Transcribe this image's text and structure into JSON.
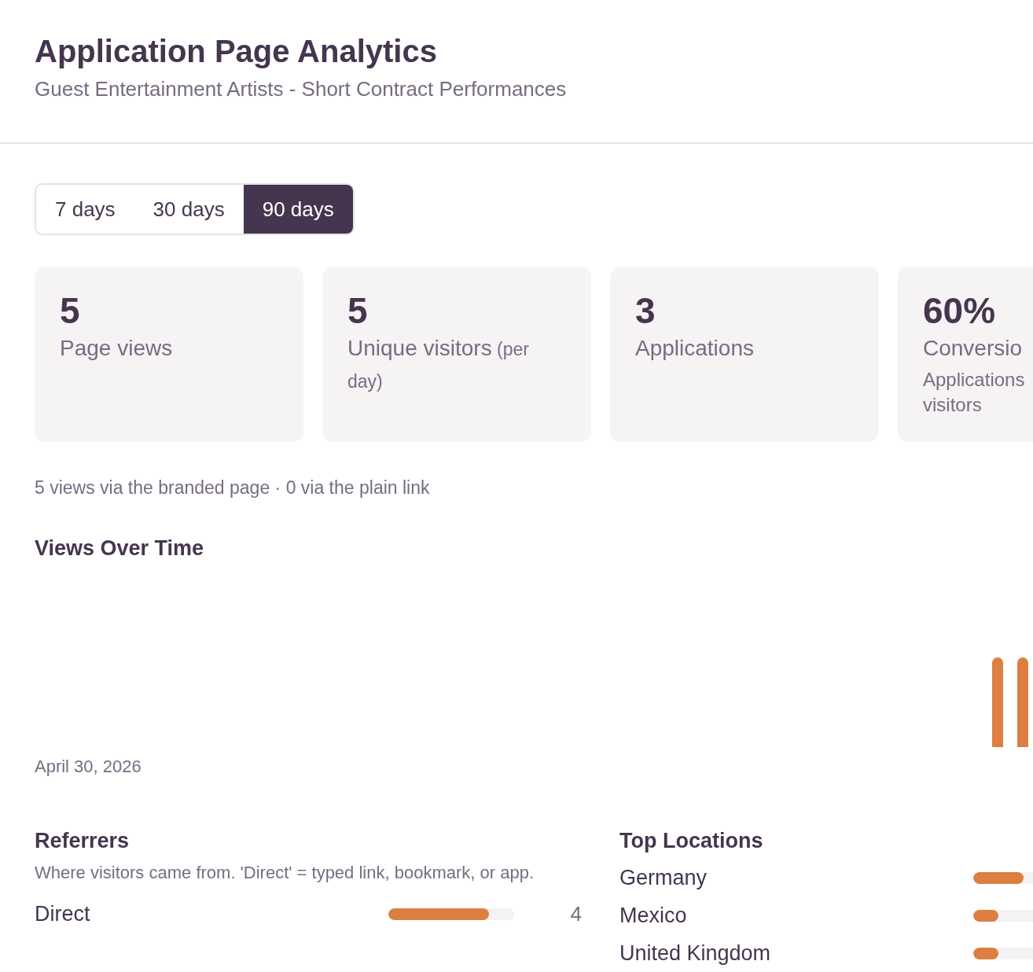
{
  "header": {
    "title": "Application Page Analytics",
    "subtitle": "Guest Entertainment Artists - Short Contract Performances"
  },
  "ranges": [
    {
      "label": "7 days",
      "selected": false
    },
    {
      "label": "30 days",
      "selected": false
    },
    {
      "label": "90 days",
      "selected": true
    }
  ],
  "stats": [
    {
      "value": "5",
      "label": "Page views"
    },
    {
      "value": "5",
      "label": "Unique visitors",
      "qualifier": "(per day)"
    },
    {
      "value": "3",
      "label": "Applications"
    },
    {
      "value": "60%",
      "label": "Conversio",
      "note": "Applications visitors"
    }
  ],
  "source_note": "5 views via the branded page · 0 via the plain link",
  "views_over_time": {
    "title": "Views Over Time",
    "start_label": "April 30, 2026"
  },
  "referrers": {
    "title": "Referrers",
    "description": "Where visitors came from. 'Direct' = typed link, bookmark, or app.",
    "items": [
      {
        "name": "Direct",
        "level": 0.8,
        "count": "4"
      }
    ]
  },
  "top_locations": {
    "title": "Top Locations",
    "items": [
      {
        "name": "Germany",
        "level": 0.4
      },
      {
        "name": "Mexico",
        "level": 0.2
      },
      {
        "name": "United Kingdom",
        "level": 0.2
      }
    ]
  }
}
